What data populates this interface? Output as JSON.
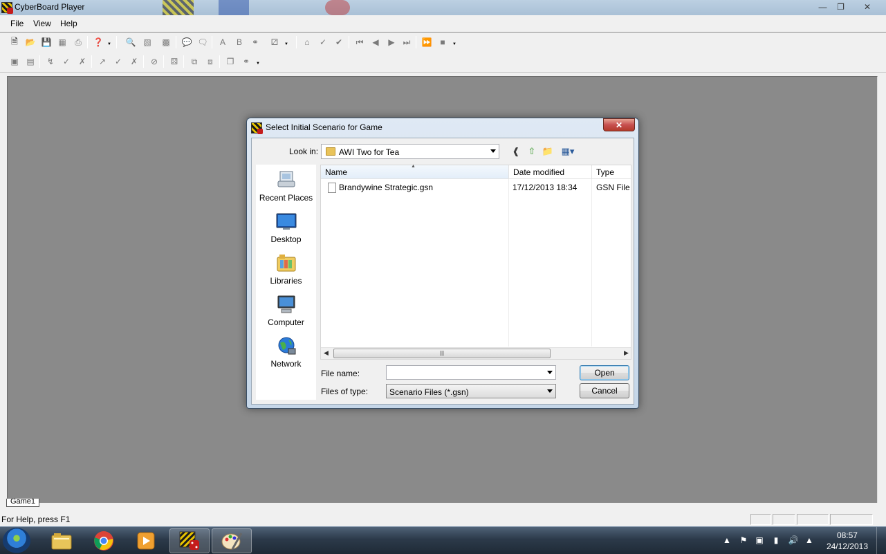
{
  "app": {
    "title": "CyberBoard Player",
    "menu": [
      "File",
      "View",
      "Help"
    ],
    "status_text": "For Help, press F1",
    "game_tab": "Game1"
  },
  "dialog": {
    "title": "Select Initial Scenario for Game",
    "look_in_label": "Look in:",
    "look_in_value": "AWI Two for Tea",
    "places": [
      {
        "label": "Recent Places",
        "icon": "recent-places-icon"
      },
      {
        "label": "Desktop",
        "icon": "desktop-icon"
      },
      {
        "label": "Libraries",
        "icon": "libraries-icon"
      },
      {
        "label": "Computer",
        "icon": "computer-icon"
      },
      {
        "label": "Network",
        "icon": "network-icon"
      }
    ],
    "columns": [
      "Name",
      "Date modified",
      "Type"
    ],
    "files": [
      {
        "name": "Brandywine Strategic.gsn",
        "date": "17/12/2013 18:34",
        "type": "GSN File"
      }
    ],
    "file_name_label": "File name:",
    "file_name_value": "",
    "files_of_type_label": "Files of type:",
    "files_of_type_value": "Scenario Files (*.gsn)",
    "open_label": "Open",
    "cancel_label": "Cancel"
  },
  "taskbar": {
    "time": "08:57",
    "date": "24/12/2013"
  },
  "colors": {
    "workspace": "#8a8a8a",
    "chrome": "#f0f0f0",
    "close_red": "#c75050",
    "taskbar": "#2c3a4a"
  }
}
